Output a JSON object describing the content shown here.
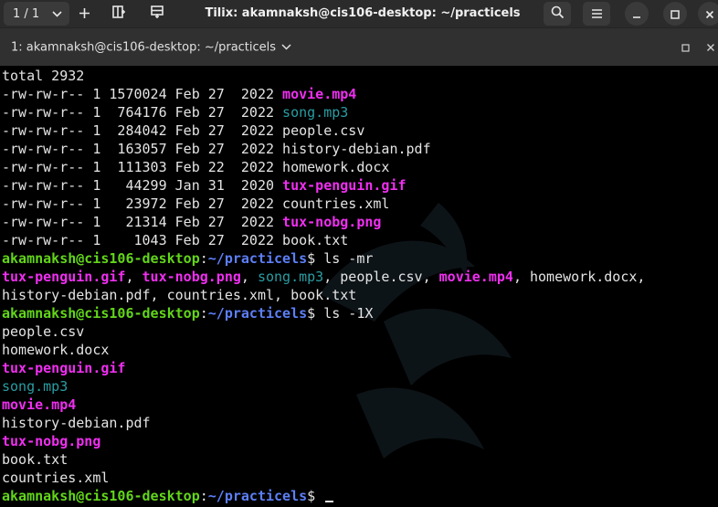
{
  "titlebar": {
    "session_label": "1 / 1",
    "window_title": "Tilix: akamnaksh@cis106-desktop: ~/practicels"
  },
  "tab": {
    "label": "1: akamnaksh@cis106-desktop: ~/practicels"
  },
  "colors": {
    "default": "#e4e4e4",
    "magenta": "#ef2ff0",
    "cyan": "#2a9da3",
    "prompt_user": "#62d51a",
    "prompt_path": "#5d7ff7",
    "background": "#000000"
  },
  "terminal": {
    "lines": [
      [
        {
          "t": "total 2932",
          "c": "default"
        }
      ],
      [
        {
          "t": "-rw-rw-r-- 1 1570024 Feb 27  2022 ",
          "c": "default"
        },
        {
          "t": "movie.mp4",
          "c": "magenta"
        }
      ],
      [
        {
          "t": "-rw-rw-r-- 1  764176 Feb 27  2022 ",
          "c": "default"
        },
        {
          "t": "song.mp3",
          "c": "cyan"
        }
      ],
      [
        {
          "t": "-rw-rw-r-- 1  284042 Feb 27  2022 people.csv",
          "c": "default"
        }
      ],
      [
        {
          "t": "-rw-rw-r-- 1  163057 Feb 27  2022 history-debian.pdf",
          "c": "default"
        }
      ],
      [
        {
          "t": "-rw-rw-r-- 1  111303 Feb 22  2022 homework.docx",
          "c": "default"
        }
      ],
      [
        {
          "t": "-rw-rw-r-- 1   44299 Jan 31  2020 ",
          "c": "default"
        },
        {
          "t": "tux-penguin.gif",
          "c": "magenta"
        }
      ],
      [
        {
          "t": "-rw-rw-r-- 1   23972 Feb 27  2022 countries.xml",
          "c": "default"
        }
      ],
      [
        {
          "t": "-rw-rw-r-- 1   21314 Feb 27  2022 ",
          "c": "default"
        },
        {
          "t": "tux-nobg.png",
          "c": "magenta"
        }
      ],
      [
        {
          "t": "-rw-rw-r-- 1    1043 Feb 27  2022 book.txt",
          "c": "default"
        }
      ],
      [
        {
          "t": "akamnaksh@cis106-desktop",
          "c": "green"
        },
        {
          "t": ":",
          "c": "default"
        },
        {
          "t": "~/practicels",
          "c": "blue"
        },
        {
          "t": "$ ls -mr",
          "c": "default"
        }
      ],
      [
        {
          "t": "tux-penguin.gif",
          "c": "magenta"
        },
        {
          "t": ", ",
          "c": "default"
        },
        {
          "t": "tux-nobg.png",
          "c": "magenta"
        },
        {
          "t": ", ",
          "c": "default"
        },
        {
          "t": "song.mp3",
          "c": "cyan"
        },
        {
          "t": ", people.csv, ",
          "c": "default"
        },
        {
          "t": "movie.mp4",
          "c": "magenta"
        },
        {
          "t": ", homework.docx,",
          "c": "default"
        }
      ],
      [
        {
          "t": "history-debian.pdf, countries.xml, book.txt",
          "c": "default"
        }
      ],
      [
        {
          "t": "akamnaksh@cis106-desktop",
          "c": "green"
        },
        {
          "t": ":",
          "c": "default"
        },
        {
          "t": "~/practicels",
          "c": "blue"
        },
        {
          "t": "$ ls -1X",
          "c": "default"
        }
      ],
      [
        {
          "t": "people.csv",
          "c": "default"
        }
      ],
      [
        {
          "t": "homework.docx",
          "c": "default"
        }
      ],
      [
        {
          "t": "tux-penguin.gif",
          "c": "magenta"
        }
      ],
      [
        {
          "t": "song.mp3",
          "c": "cyan"
        }
      ],
      [
        {
          "t": "movie.mp4",
          "c": "magenta"
        }
      ],
      [
        {
          "t": "history-debian.pdf",
          "c": "default"
        }
      ],
      [
        {
          "t": "tux-nobg.png",
          "c": "magenta"
        }
      ],
      [
        {
          "t": "book.txt",
          "c": "default"
        }
      ],
      [
        {
          "t": "countries.xml",
          "c": "default"
        }
      ],
      [
        {
          "t": "akamnaksh@cis106-desktop",
          "c": "green"
        },
        {
          "t": ":",
          "c": "default"
        },
        {
          "t": "~/practicels",
          "c": "blue"
        },
        {
          "t": "$ ",
          "c": "default"
        }
      ]
    ]
  },
  "icons": {
    "session_dropdown": "chevron-down-icon",
    "new_session": "plus-icon",
    "split_right": "split-horizontal-icon",
    "split_down": "split-vertical-icon",
    "find": "search-icon",
    "menu": "hamburger-menu-icon",
    "minimize": "minimize-icon",
    "maximize": "maximize-icon",
    "close": "close-icon",
    "tab_dropdown": "chevron-down-icon",
    "tab_maximize": "maximize-terminal-icon",
    "tab_close": "close-terminal-icon"
  }
}
